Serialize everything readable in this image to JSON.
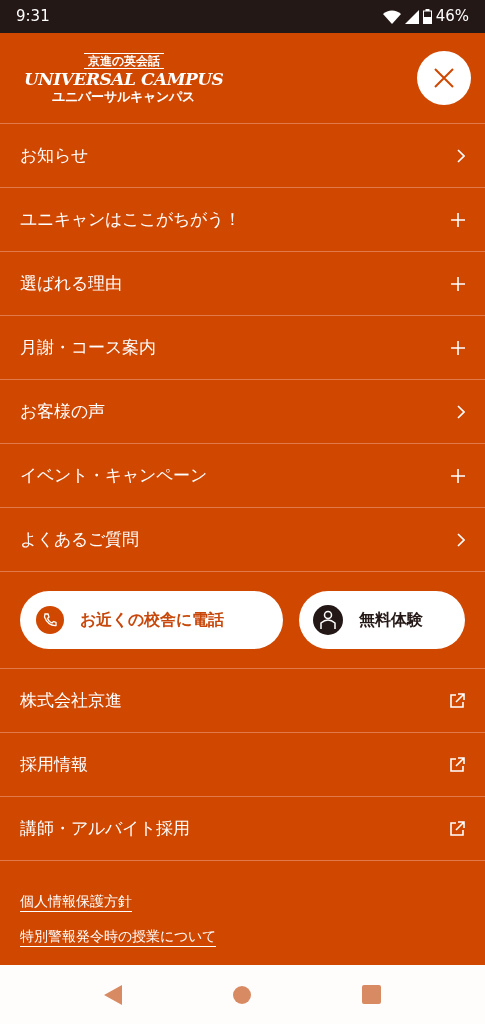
{
  "status_bar": {
    "time": "9:31",
    "battery": "46%"
  },
  "logo": {
    "tagline": "京進の英会話",
    "wordmark": "UNIVERSAL CAMPUS",
    "kana": "ユニバーサルキャンパス"
  },
  "menu": [
    {
      "label": "お知らせ",
      "kind": "link"
    },
    {
      "label": "ユニキャンはここがちがう！",
      "kind": "expand"
    },
    {
      "label": "選ばれる理由",
      "kind": "expand"
    },
    {
      "label": "月謝・コース案内",
      "kind": "expand"
    },
    {
      "label": "お客様の声",
      "kind": "link"
    },
    {
      "label": "イベント・キャンペーン",
      "kind": "expand"
    },
    {
      "label": "よくあるご質問",
      "kind": "link"
    }
  ],
  "actions": [
    {
      "label": "お近くの校舎に電話",
      "kind": "phone"
    },
    {
      "label": "無料体験",
      "kind": "trial"
    }
  ],
  "external_links": [
    "株式会社京進",
    "採用情報",
    "講師・アルバイト採用"
  ],
  "footer_links": [
    "個人情報保護方針",
    "特別警報発令時の授業について"
  ]
}
